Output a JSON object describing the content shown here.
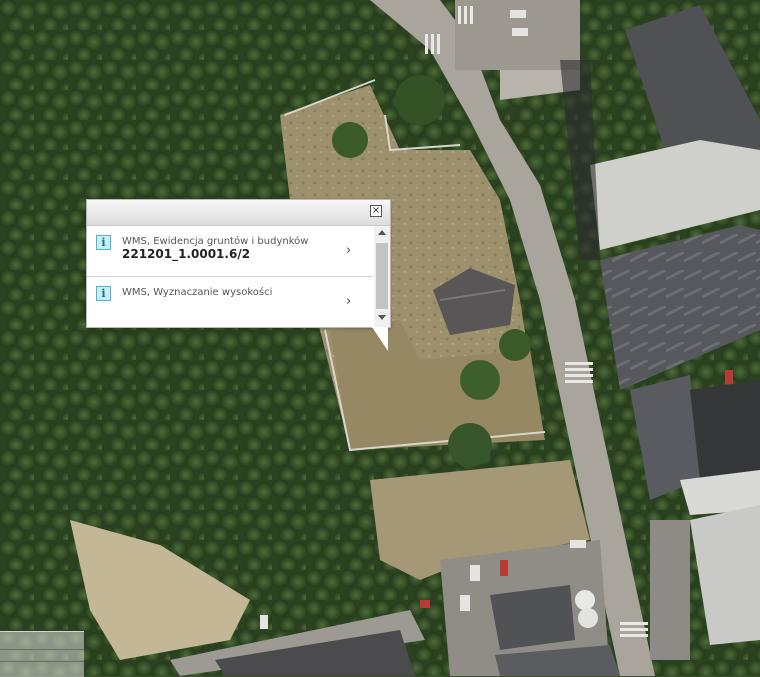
{
  "map": {
    "type": "orthophoto",
    "colors": {
      "forest": "#2f4a24",
      "dry_ground": "#a99a74",
      "road": "#a7a39a",
      "roof_dark": "#4a4b4f",
      "roof_light": "#c9cbcc"
    }
  },
  "popup": {
    "close_icon": "close-icon",
    "results": [
      {
        "icon": "info-icon",
        "icon_glyph": "i",
        "source": "WMS, Ewidencja gruntów i budynków",
        "value": "221201_1.0001.6/2",
        "chevron": "›"
      },
      {
        "icon": "info-icon",
        "icon_glyph": "i",
        "source": "WMS, Wyznaczanie wysokości",
        "value": "",
        "chevron": "›"
      }
    ]
  }
}
